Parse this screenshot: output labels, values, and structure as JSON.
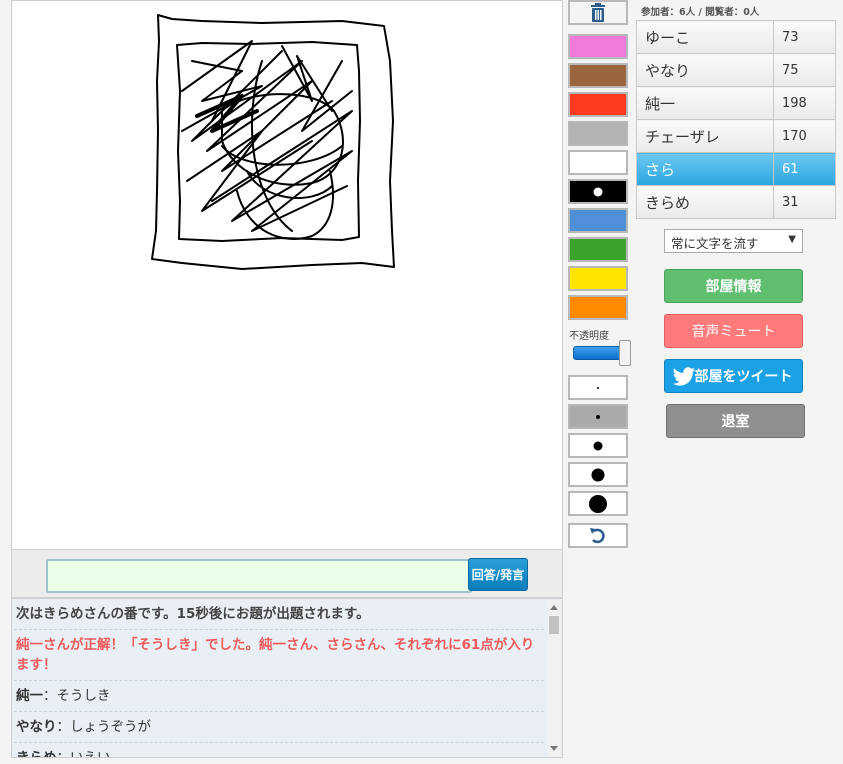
{
  "answer": {
    "button_label": "回答/発言",
    "value": ""
  },
  "chat": [
    {
      "type": "system",
      "text": "次はきらめさんの番です。15秒後にお題が出題されます。"
    },
    {
      "type": "correct",
      "text": "純一さんが正解！「そうしき」でした。純一さん、さらさん、それぞれに61点が入ります！"
    },
    {
      "type": "message",
      "speaker": "純一",
      "text": "そうしき"
    },
    {
      "type": "message",
      "speaker": "やなり",
      "text": "しょうぞうが"
    },
    {
      "type": "message",
      "speaker": "きらめ",
      "text": "いえい"
    }
  ],
  "palette": [
    {
      "name": "trash",
      "icon": "trash-icon"
    },
    {
      "name": "pink",
      "color": "#ee7ad9"
    },
    {
      "name": "brown",
      "color": "#9b6540"
    },
    {
      "name": "red",
      "color": "#ff3a1e"
    },
    {
      "name": "gray",
      "color": "#b3b3b3"
    },
    {
      "name": "white",
      "color": "#ffffff"
    },
    {
      "name": "black",
      "color": "#000000",
      "selected": true
    },
    {
      "name": "blue",
      "color": "#4e8fd8"
    },
    {
      "name": "green",
      "color": "#3aa52a"
    },
    {
      "name": "yellow",
      "color": "#ffe400"
    },
    {
      "name": "orange",
      "color": "#ff8a00"
    }
  ],
  "opacity": {
    "label": "不透明度",
    "value": 1.0
  },
  "brush_sizes": [
    {
      "size": 2,
      "selected": false
    },
    {
      "size": 4,
      "selected": true
    },
    {
      "size": 9,
      "selected": false
    },
    {
      "size": 13,
      "selected": false
    },
    {
      "size": 18,
      "selected": false
    }
  ],
  "undo_icon": "undo-icon",
  "participants_info": "参加者：6人 / 閲覧者：0人",
  "players": [
    {
      "name": "ゆーこ",
      "score": "73",
      "active": false
    },
    {
      "name": "やなり",
      "score": "75",
      "active": false
    },
    {
      "name": "純一",
      "score": "198",
      "active": false
    },
    {
      "name": "チェーザレ",
      "score": "170",
      "active": false
    },
    {
      "name": "さら",
      "score": "61",
      "active": true
    },
    {
      "name": "きらめ",
      "score": "31",
      "active": false
    }
  ],
  "mode_select": {
    "value": "常に文字を流す"
  },
  "buttons": {
    "room_info": "部屋情報",
    "mute": "音声ミュート",
    "tweet": "部屋をツイート",
    "leave": "退室"
  }
}
